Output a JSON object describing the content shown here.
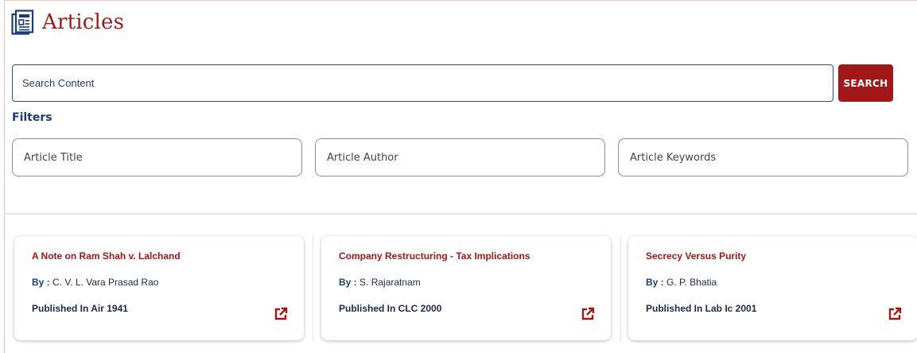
{
  "page": {
    "title": "Articles",
    "icon": "newspaper-icon",
    "accent_color": "#a01818"
  },
  "search": {
    "placeholder": "Search Content",
    "value": "",
    "button_label": "SEARCH"
  },
  "filters": {
    "label": "Filters",
    "fields": [
      {
        "placeholder": "Article Title",
        "value": ""
      },
      {
        "placeholder": "Article Author",
        "value": ""
      },
      {
        "placeholder": "Article Keywords",
        "value": ""
      }
    ]
  },
  "articles": [
    {
      "title": "A Note on Ram Shah v. Lalchand",
      "by_label": "By :",
      "author": "C. V. L. Vara Prasad Rao",
      "published": "Published In Air 1941",
      "action_icon": "external-link-icon"
    },
    {
      "title": "Company Restructuring - Tax Implications",
      "by_label": "By :",
      "author": "S. Rajaratnam",
      "published": "Published In CLC 2000",
      "action_icon": "external-link-icon"
    },
    {
      "title": "Secrecy Versus Purity",
      "by_label": "By :",
      "author": "G. P. Bhatia",
      "published": "Published In Lab Ic 2001",
      "action_icon": "external-link-icon"
    }
  ]
}
